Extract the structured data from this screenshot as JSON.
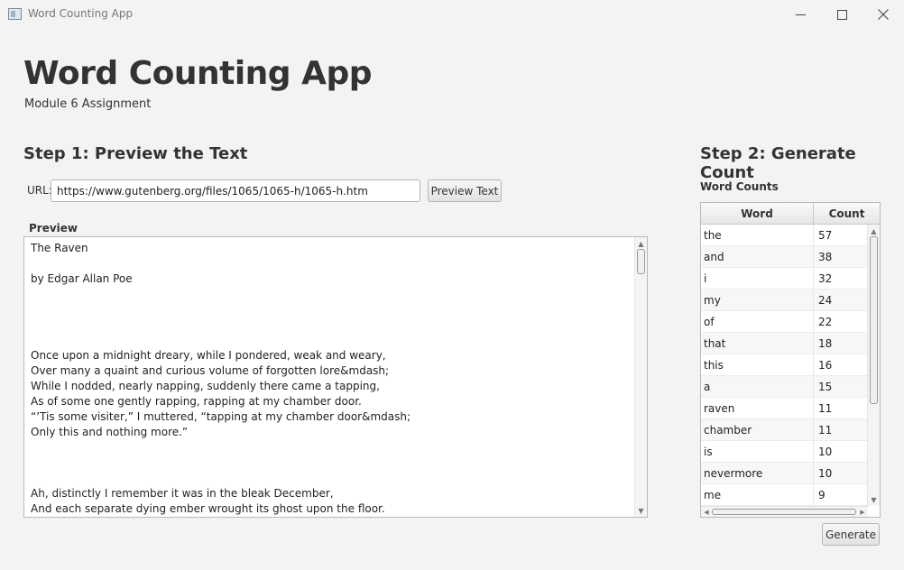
{
  "window": {
    "title": "Word Counting App",
    "controls": {
      "minimize": "—",
      "maximize": "☐",
      "close": "✕"
    }
  },
  "header": {
    "title": "Word Counting App",
    "subtitle": "Module 6 Assignment"
  },
  "step1": {
    "heading": "Step 1: Preview the Text",
    "url_label": "URL:",
    "url_value": "https://www.gutenberg.org/files/1065/1065-h/1065-h.htm",
    "preview_button": "Preview Text",
    "preview_label": "Preview",
    "preview_text": "The Raven\n\nby Edgar Allan Poe\n\n\n\n\nOnce upon a midnight dreary, while I pondered, weak and weary,\nOver many a quaint and curious volume of forgotten lore&mdash;\nWhile I nodded, nearly napping, suddenly there came a tapping,\nAs of some one gently rapping, rapping at my chamber door.\n“’Tis some visiter,” I muttered, “tapping at my chamber door&mdash;\nOnly this and nothing more.”\n\n\n\nAh, distinctly I remember it was in the bleak December,\nAnd each separate dying ember wrought its ghost upon the floor."
  },
  "step2": {
    "heading": "Step 2: Generate Count",
    "counts_label": "Word Counts",
    "columns": [
      "Word",
      "Count"
    ],
    "rows": [
      {
        "word": "the",
        "count": "57"
      },
      {
        "word": "and",
        "count": "38"
      },
      {
        "word": "i",
        "count": "32"
      },
      {
        "word": "my",
        "count": "24"
      },
      {
        "word": "of",
        "count": "22"
      },
      {
        "word": "that",
        "count": "18"
      },
      {
        "word": "this",
        "count": "16"
      },
      {
        "word": "a",
        "count": "15"
      },
      {
        "word": "raven",
        "count": "11"
      },
      {
        "word": "chamber",
        "count": "11"
      },
      {
        "word": "is",
        "count": "10"
      },
      {
        "word": "nevermore",
        "count": "10"
      },
      {
        "word": "me",
        "count": "9"
      }
    ],
    "generate_button": "Generate"
  }
}
